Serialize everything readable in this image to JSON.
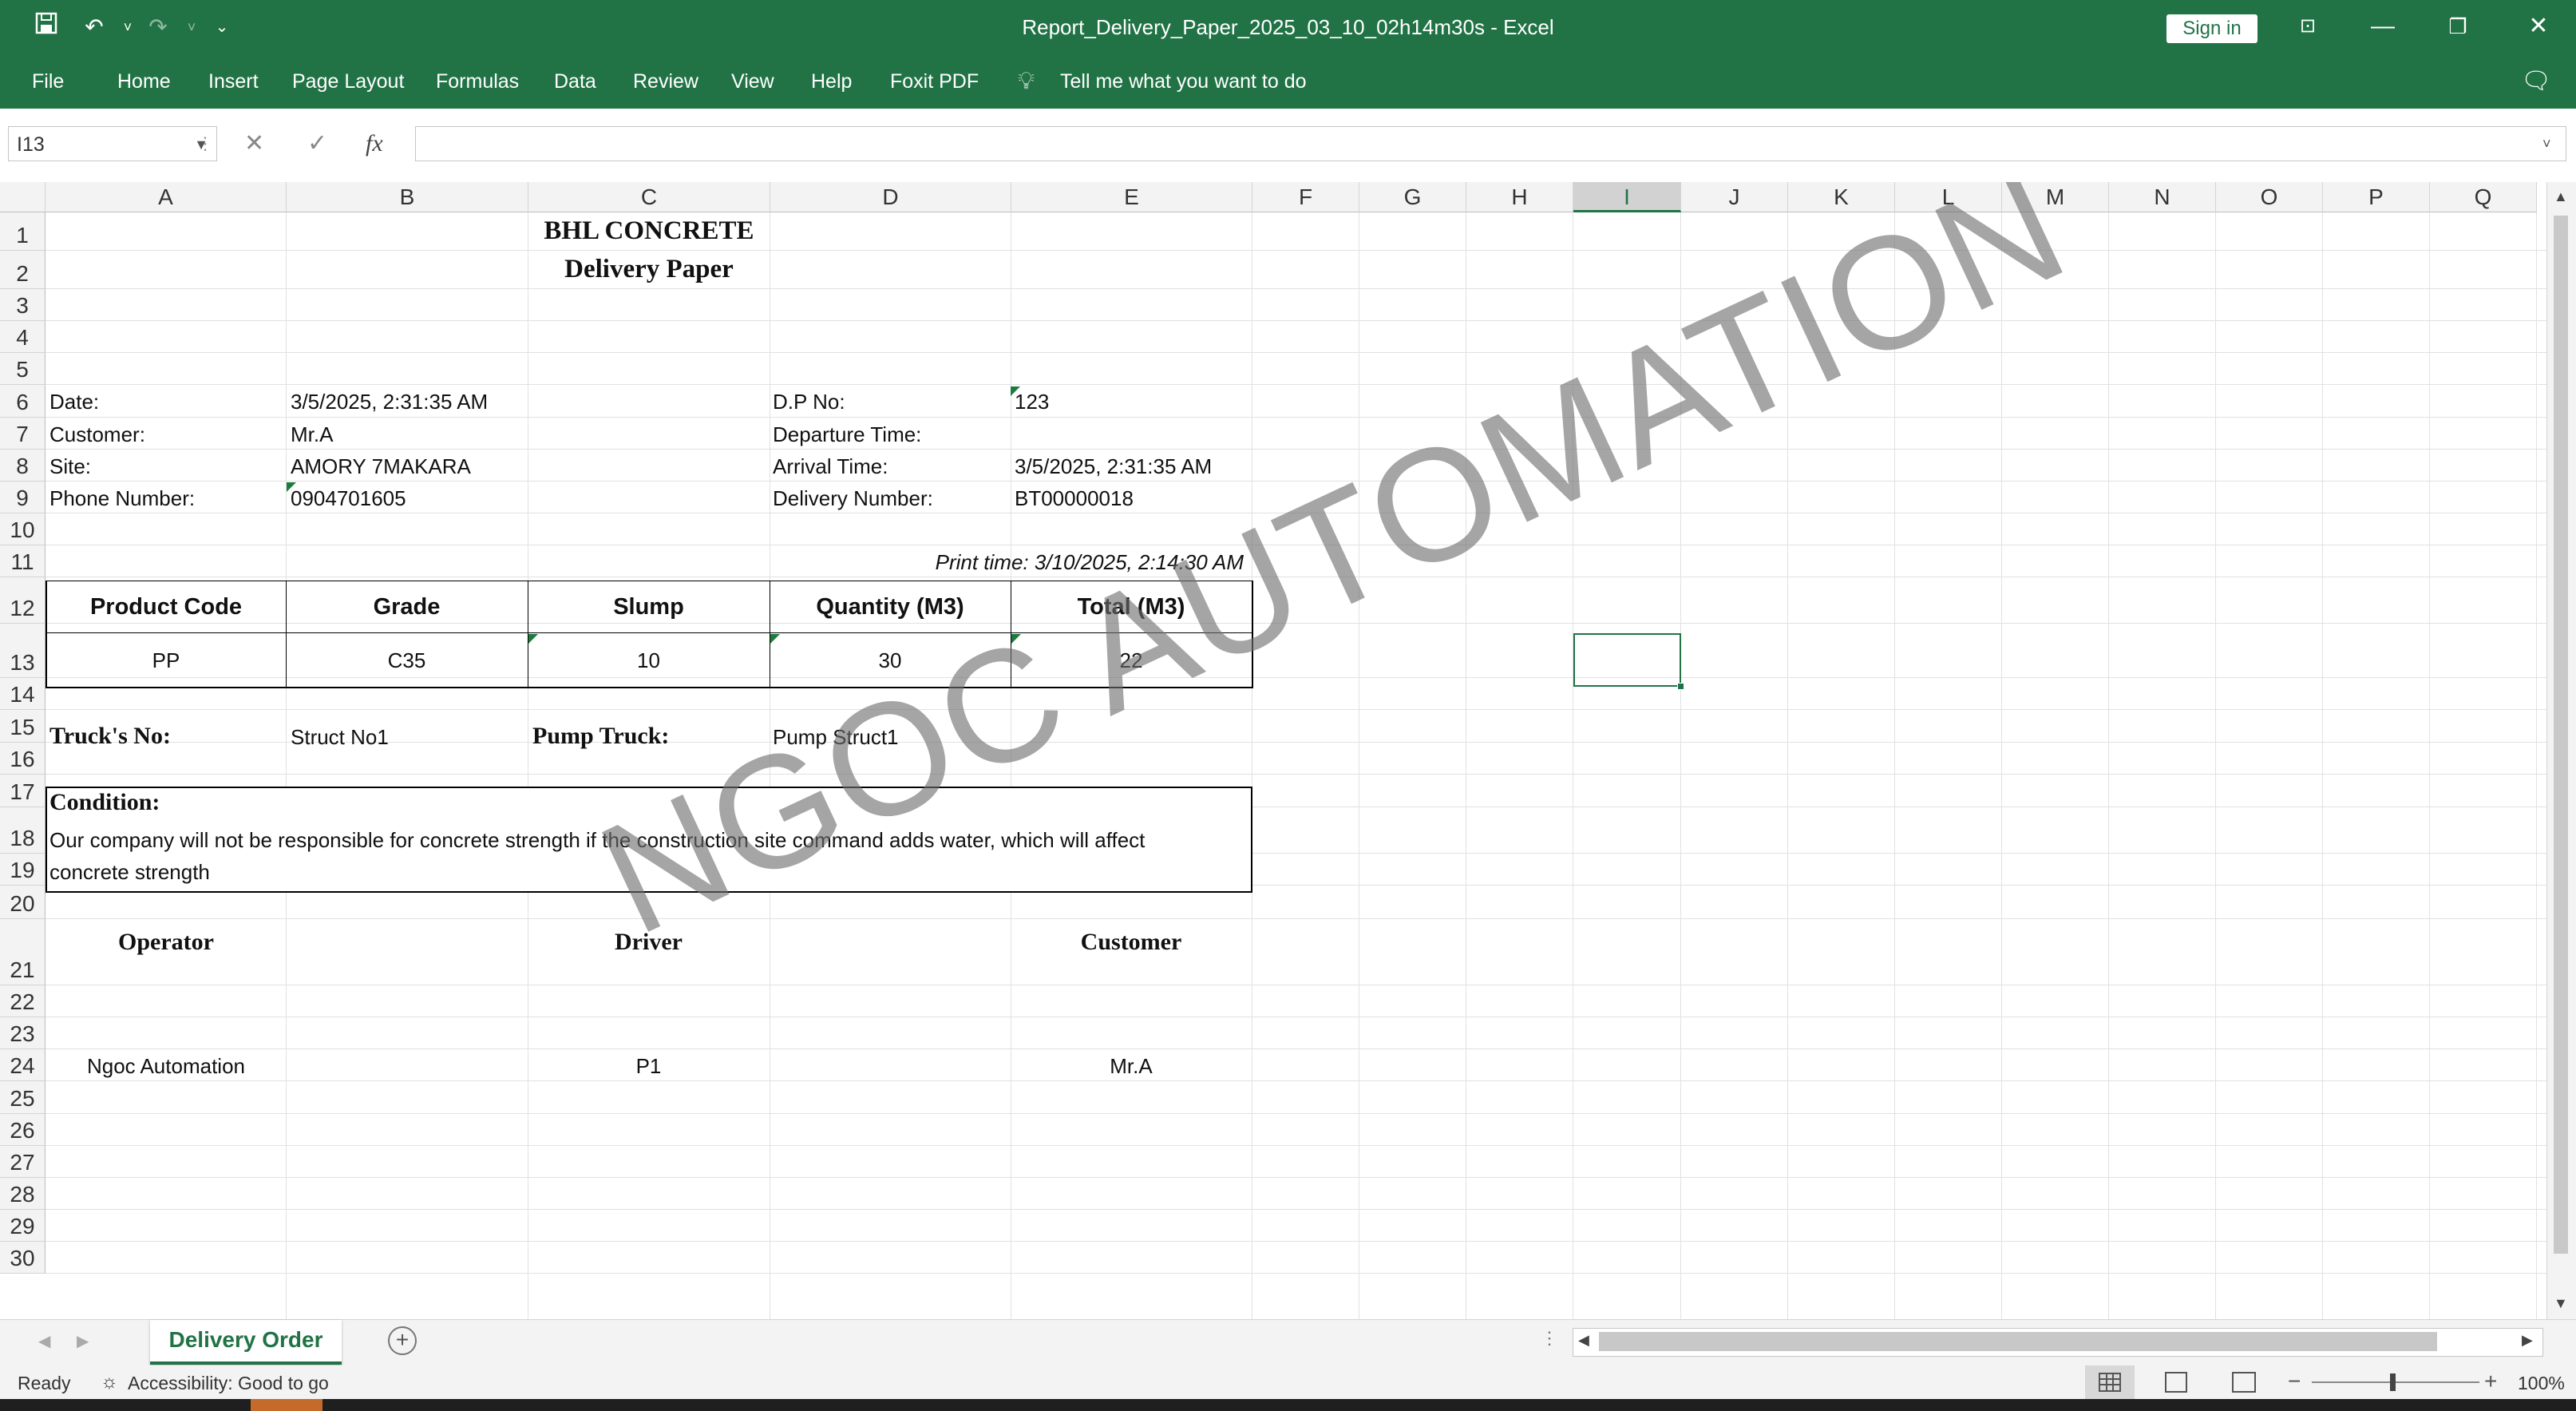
{
  "window": {
    "title": "Report_Delivery_Paper_2025_03_10_02h14m30s  -  Excel",
    "sign_in": "Sign in"
  },
  "ribbon": {
    "tabs": [
      "File",
      "Home",
      "Insert",
      "Page Layout",
      "Formulas",
      "Data",
      "Review",
      "View",
      "Help",
      "Foxit PDF"
    ],
    "tell_me": "Tell me what you want to do"
  },
  "formula_bar": {
    "name_box": "I13",
    "fx": "fx",
    "value": ""
  },
  "columns": [
    "A",
    "B",
    "C",
    "D",
    "E",
    "F",
    "G",
    "H",
    "I",
    "J",
    "K",
    "L",
    "M",
    "N",
    "O",
    "P",
    "Q"
  ],
  "selected_column": "I",
  "rows": [
    "1",
    "2",
    "3",
    "4",
    "5",
    "6",
    "7",
    "8",
    "9",
    "10",
    "11",
    "12",
    "13",
    "14",
    "15",
    "16",
    "17",
    "18",
    "19",
    "20",
    "21",
    "22",
    "23",
    "24",
    "25",
    "26",
    "27",
    "28",
    "29",
    "30"
  ],
  "report": {
    "company": "BHL CONCRETE",
    "doc_title": "Delivery Paper",
    "date_label": "Date:",
    "date_value": "3/5/2025, 2:31:35 AM",
    "customer_label": "Customer:",
    "customer_value": "Mr.A",
    "site_label": "Site:",
    "site_value": "AMORY 7MAKARA",
    "phone_label": "Phone Number:",
    "phone_value": "0904701605",
    "dp_label": "D.P No:",
    "dp_value": "123",
    "departure_label": "Departure Time:",
    "arrival_label": "Arrival Time:",
    "arrival_value": "3/5/2025, 2:31:35 AM",
    "delivery_label": "Delivery Number:",
    "delivery_value": "BT00000018",
    "print_time": "Print time: 3/10/2025, 2:14:30 AM",
    "table_headers": [
      "Product Code",
      "Grade",
      "Slump",
      "Quantity (M3)",
      "Total (M3)"
    ],
    "table_row": [
      "PP",
      "C35",
      "10",
      "30",
      "22"
    ],
    "truck_label": "Truck's No:",
    "truck_value": "Struct No1",
    "pump_label": "Pump Truck:",
    "pump_value": "Pump Struct1",
    "condition_label": "Condition:",
    "condition_text_1": "Our company will not be responsible for concrete strength if the construction site command adds water, which will affect",
    "condition_text_2": "concrete strength",
    "sig_operator": "Operator",
    "sig_driver": "Driver",
    "sig_customer": "Customer",
    "operator_name": "Ngoc Automation",
    "driver_name": "P1",
    "customer_name": "Mr.A"
  },
  "watermark": "NGOC AUTOMATION",
  "sheet_tab": "Delivery Order",
  "status": {
    "ready": "Ready",
    "accessibility": "Accessibility: Good to go",
    "zoom": "100%"
  }
}
